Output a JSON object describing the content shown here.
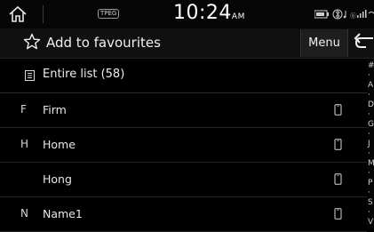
{
  "status_bar": {
    "tpeg_label": "TPEG",
    "time": "10:24",
    "ampm": "AM"
  },
  "header": {
    "title": "Add to favourites",
    "menu_label": "Menu"
  },
  "entire_list": {
    "label": "Entire list (58)"
  },
  "contacts": [
    {
      "letter": "F",
      "name": "Firm"
    },
    {
      "letter": "H",
      "name": "Home"
    },
    {
      "letter": "",
      "name": "Hong"
    },
    {
      "letter": "N",
      "name": "Name1"
    }
  ],
  "index_letters": [
    "#",
    "·",
    "A",
    "·",
    "D",
    "·",
    "G",
    "·",
    "J",
    "·",
    "M",
    "·",
    "P",
    "·",
    "S",
    "·",
    "V"
  ],
  "colors": {
    "background": "#000000",
    "text": "#e6e6e6",
    "divider": "#242424"
  }
}
